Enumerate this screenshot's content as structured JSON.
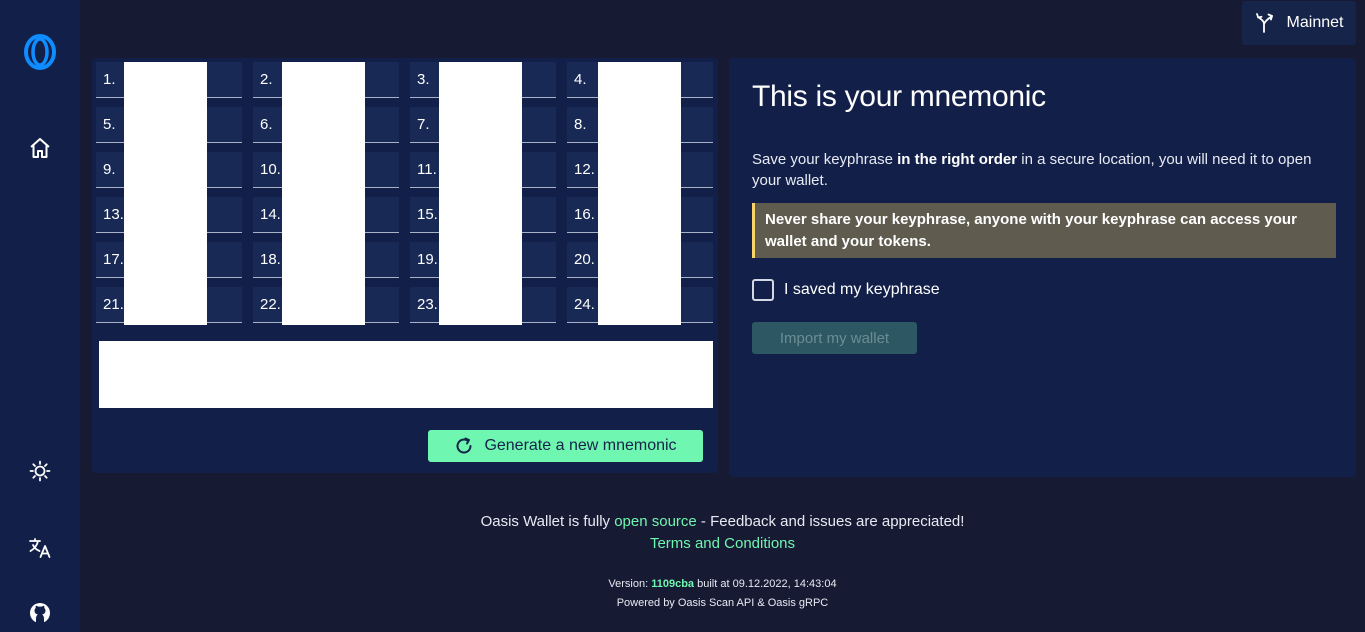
{
  "network": {
    "label": "Mainnet"
  },
  "sidebar": {
    "items": [
      {
        "name": "oasis-logo"
      },
      {
        "name": "home"
      },
      {
        "name": "theme"
      },
      {
        "name": "language"
      },
      {
        "name": "github"
      }
    ]
  },
  "mnemonic": {
    "words": [
      {
        "label": "1."
      },
      {
        "label": "2."
      },
      {
        "label": "3."
      },
      {
        "label": "4."
      },
      {
        "label": "5."
      },
      {
        "label": "6."
      },
      {
        "label": "7."
      },
      {
        "label": "8."
      },
      {
        "label": "9."
      },
      {
        "label": "10."
      },
      {
        "label": "11."
      },
      {
        "label": "12."
      },
      {
        "label": "13."
      },
      {
        "label": "14."
      },
      {
        "label": "15."
      },
      {
        "label": "16."
      },
      {
        "label": "17."
      },
      {
        "label": "18."
      },
      {
        "label": "19."
      },
      {
        "label": "20."
      },
      {
        "label": "21."
      },
      {
        "label": "22."
      },
      {
        "label": "23."
      },
      {
        "label": "24."
      }
    ],
    "generate_label": "Generate a new mnemonic"
  },
  "info": {
    "title": "This is your mnemonic",
    "desc_pre": "Save your keyphrase ",
    "desc_bold": "in the right order",
    "desc_post": " in a secure location, you will need it to open your wallet.",
    "warning": "Never share your keyphrase, anyone with your keyphrase can access your wallet and your tokens.",
    "checkbox_label": "I saved my keyphrase",
    "import_label": "Import my wallet"
  },
  "footer": {
    "line1_pre": "Oasis Wallet is fully ",
    "open_source": "open source",
    "line1_post": " - Feedback and issues are appreciated!",
    "terms": "Terms and Conditions",
    "version_label": "Version: ",
    "version": "1109cba",
    "built": " built at 09.12.2022, 14:43:04",
    "powered": "Powered by Oasis Scan API & Oasis gRPC"
  },
  "colors": {
    "accent": "#6ff6b0",
    "sidebar_bg": "#122049",
    "page_bg": "#171a33",
    "warning_border": "#f7d36a"
  }
}
